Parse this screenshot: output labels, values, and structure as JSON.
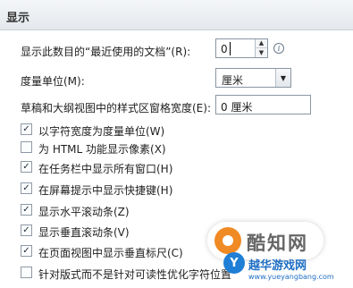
{
  "section": {
    "title": "显示"
  },
  "recent_docs": {
    "label": "显示此数目的“最近使用的文档”(R):",
    "value": "0"
  },
  "units": {
    "label": "度量单位(M):",
    "value": "厘米"
  },
  "style_width": {
    "label": "草稿和大纲视图中的样式区窗格宽度(E):",
    "value": "0 厘米"
  },
  "checkboxes": [
    {
      "label": "以字符宽度为度量单位(W)",
      "checked": true
    },
    {
      "label": "为 HTML 功能显示像素(X)",
      "checked": false
    },
    {
      "label": "在任务栏中显示所有窗口(H)",
      "checked": true
    },
    {
      "label": "在屏幕提示中显示快捷键(H)",
      "checked": true
    },
    {
      "label": "显示水平滚动条(Z)",
      "checked": true
    },
    {
      "label": "显示垂直滚动条(V)",
      "checked": true
    },
    {
      "label": "在页面视图中显示垂直标尺(C)",
      "checked": true
    },
    {
      "label": "针对版式而不是针对可读性优化字符位置",
      "checked": false
    }
  ],
  "watermark": {
    "brand": "酷知网",
    "site_name": "越华游戏网",
    "site_url": "www.yueyangbang.com"
  },
  "icons": {
    "info": "info-icon",
    "spin_up": "triangle-up-icon",
    "spin_down": "triangle-down-icon",
    "dropdown": "triangle-down-icon",
    "check": "checkmark-icon"
  },
  "colors": {
    "header_bg": "#e4e8ec",
    "border": "#8a95a3",
    "watermark_orange": "#f08a24",
    "watermark_blue": "#1f7fd6"
  }
}
